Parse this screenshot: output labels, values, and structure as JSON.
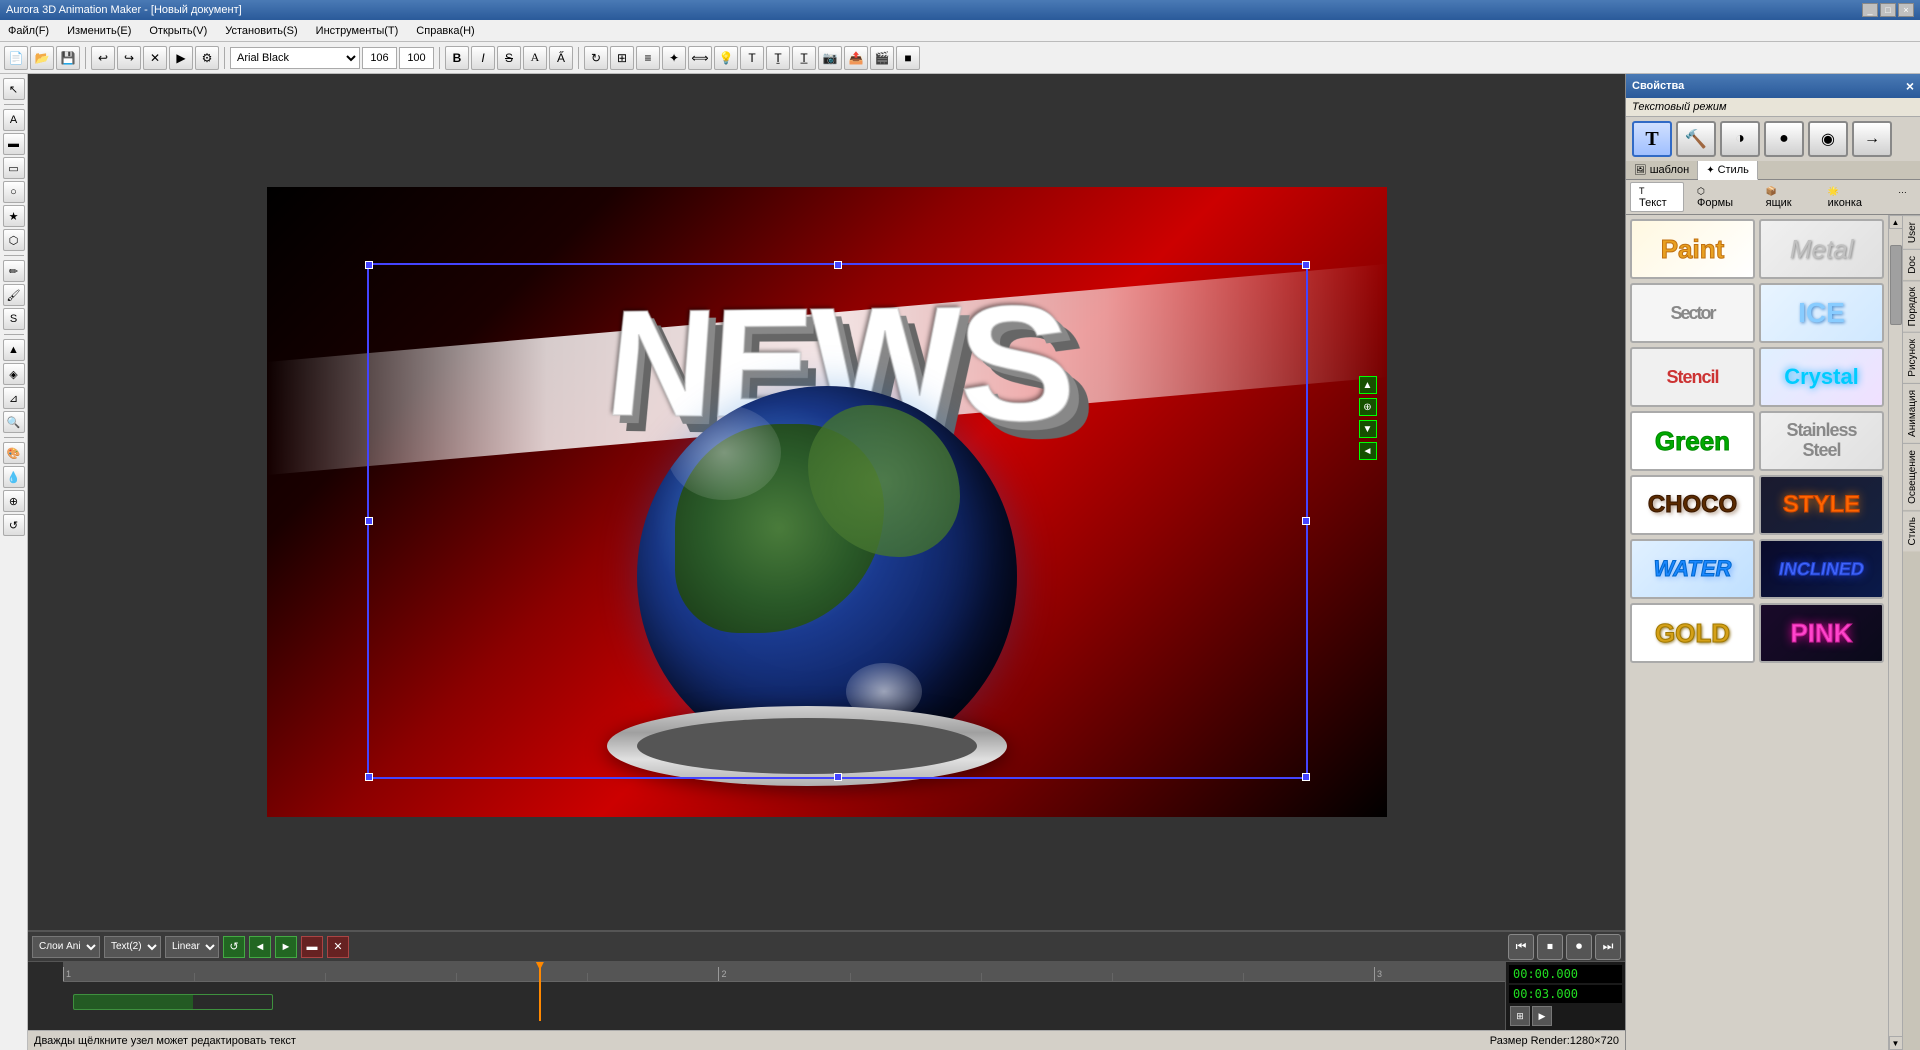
{
  "app": {
    "title": "Aurora 3D Animation Maker - [Новый документ]",
    "title_buttons": [
      "_",
      "□",
      "×"
    ]
  },
  "menu": {
    "items": [
      "Файл(F)",
      "Изменить(E)",
      "Открыть(V)",
      "Установить(S)",
      "Инструменты(T)",
      "Справка(H)"
    ]
  },
  "toolbar": {
    "font_name": "Arial Black",
    "font_size": "106",
    "font_scale": "100",
    "bold": "B",
    "italic": "I",
    "strikethrough": "S",
    "shadow": "A"
  },
  "properties_panel": {
    "title": "Свойства",
    "close": "×",
    "mode_label": "Текстовый режим",
    "tabs_main": [
      "шаблон",
      "Стиль"
    ],
    "tabs_sub": [
      "Текст",
      "Формы",
      "ящик",
      "иконка"
    ],
    "styles": [
      {
        "id": "paint",
        "label": "Paint",
        "bg": "#fff8e1"
      },
      {
        "id": "metal",
        "label": "Metal",
        "bg": "#f0f0f0"
      },
      {
        "id": "sector",
        "label": "Sector",
        "bg": "#f5f5f5"
      },
      {
        "id": "ice",
        "label": "ICE",
        "bg": "#e8f4ff"
      },
      {
        "id": "stencil",
        "label": "Stencil",
        "bg": "#f0f0f0"
      },
      {
        "id": "crystal",
        "label": "Crystal",
        "bg": "#e0f0ff"
      },
      {
        "id": "green",
        "label": "Green",
        "bg": "#ffffff"
      },
      {
        "id": "stainless",
        "label": "Stainless Steel",
        "bg": "#f0f0f0"
      },
      {
        "id": "choco",
        "label": "CHOCO",
        "bg": "#ffffff"
      },
      {
        "id": "stylr",
        "label": "STYLE",
        "bg": "#1a1a2e"
      },
      {
        "id": "water",
        "label": "WATER",
        "bg": "#e0f0ff"
      },
      {
        "id": "inclined",
        "label": "INCLINED",
        "bg": "#0a0a2a"
      },
      {
        "id": "gold",
        "label": "GOLD",
        "bg": "#ffffff"
      },
      {
        "id": "pink",
        "label": "PINK",
        "bg": "#1a0a2a"
      }
    ],
    "side_tabs": [
      "User",
      "Doc",
      "Порядок",
      "Рисунок",
      "Анимация",
      "Освещение",
      "Стиль"
    ]
  },
  "canvas": {
    "news_text": "NEWS",
    "scene_desc": "3D NEWS globe animation scene"
  },
  "timeline": {
    "layer_select": "Слои Ani",
    "object_select": "Text(2)",
    "interpolation": "Linear",
    "current_time": "00:00.000",
    "total_time": "00:03.000",
    "status": "Дважды щёлкните узел может редактировать текст",
    "render_size": "Размер Render:1280×720"
  },
  "transport": {
    "buttons": [
      "⏮",
      "⏹",
      "⏺",
      "⏭"
    ]
  }
}
